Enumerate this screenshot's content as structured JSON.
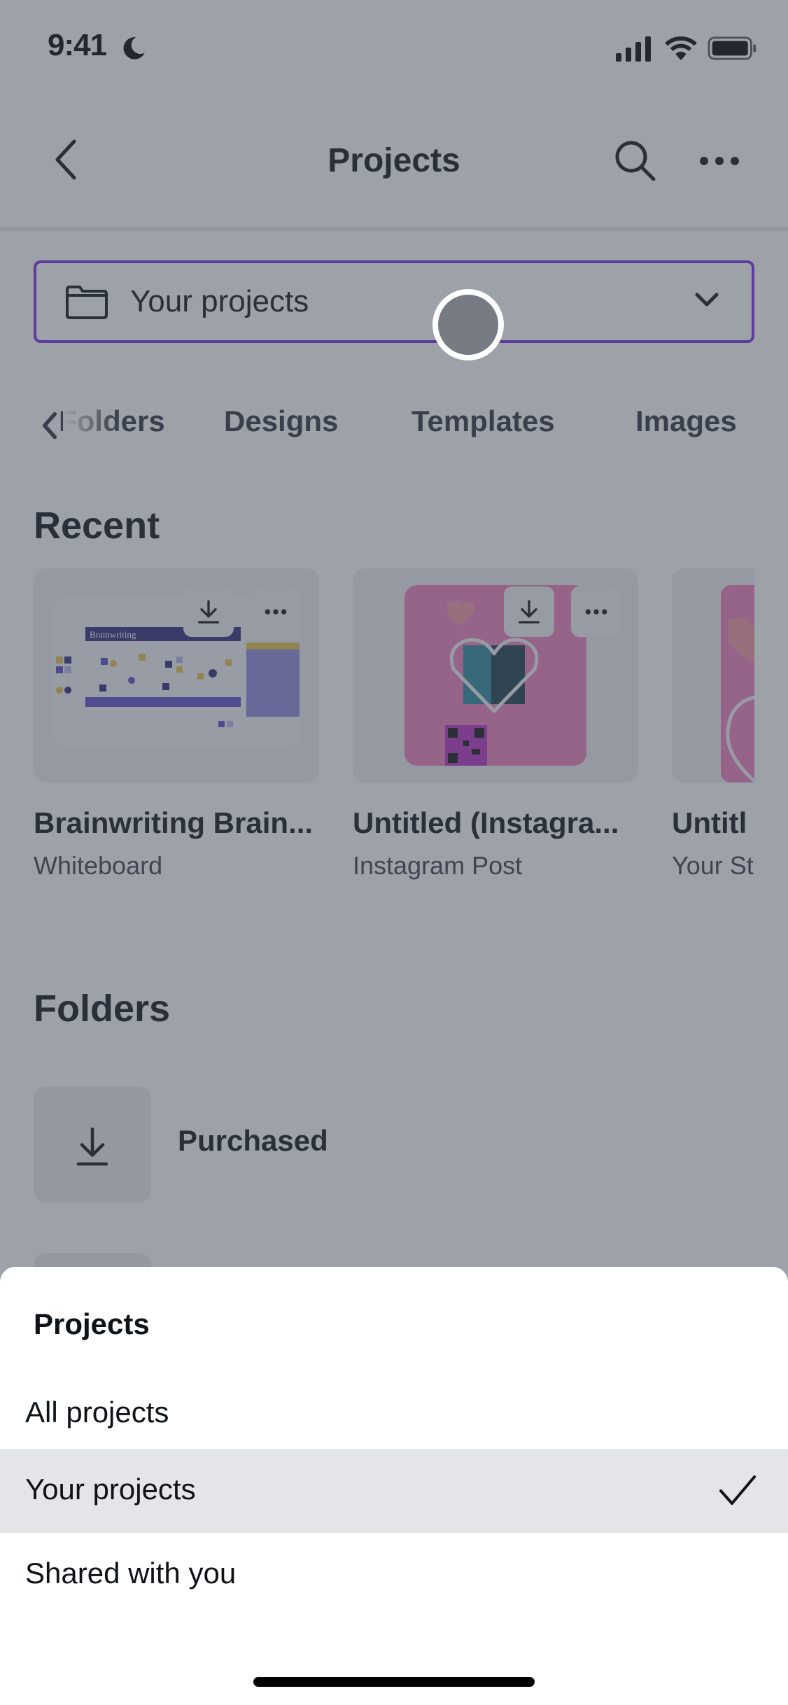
{
  "status_bar": {
    "time": "9:41",
    "icons": [
      "moon-icon",
      "cellular-signal-icon",
      "wifi-icon",
      "battery-icon"
    ]
  },
  "nav": {
    "title": "Projects",
    "icons": [
      "chevron-left-icon",
      "search-icon",
      "more-horizontal-icon"
    ]
  },
  "filter_dropdown": {
    "icon": "folder-icon",
    "selected_value": "Your projects",
    "accent_color": "#7d2ae8"
  },
  "tabs": [
    {
      "label": "Folders"
    },
    {
      "label": "Designs"
    },
    {
      "label": "Templates"
    },
    {
      "label": "Images"
    }
  ],
  "recent": {
    "heading": "Recent",
    "items": [
      {
        "title": "Brainwriting Brain...",
        "subtitle": "Whiteboard",
        "thumb_text": "Brainwriting"
      },
      {
        "title": "Untitled (Instagra...",
        "subtitle": "Instagram Post"
      },
      {
        "title": "Untitl",
        "subtitle": "Your St"
      }
    ]
  },
  "folders": {
    "heading": "Folders",
    "items": [
      {
        "label": "Purchased",
        "icon": "download-icon"
      }
    ]
  },
  "sheet": {
    "title": "Projects",
    "options": [
      {
        "label": "All projects",
        "selected": false
      },
      {
        "label": "Your projects",
        "selected": true
      },
      {
        "label": "Shared with you",
        "selected": false
      }
    ]
  }
}
